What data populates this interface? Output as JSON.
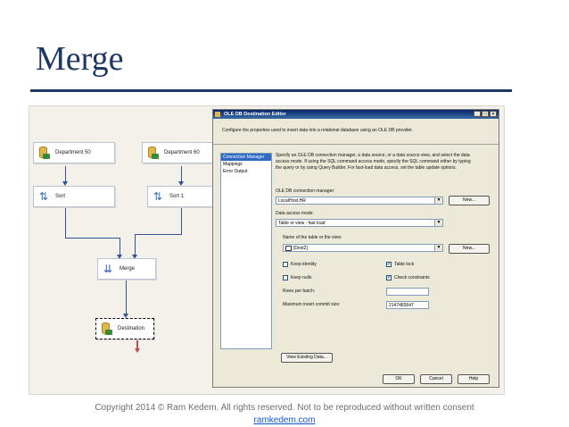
{
  "slide": {
    "title": "Merge",
    "copyright": "Copyright 2014 © Ram Kedem. All rights reserved. Not to be reproduced without written consent",
    "link": "ramkedem.com"
  },
  "flow": {
    "nodes": {
      "dept50": "Department 50",
      "dept60": "Department 60",
      "sort": "Sort",
      "sort1": "Sort 1",
      "merge": "Merge",
      "destination": "Destination"
    }
  },
  "dialog": {
    "title": "OLE DB Destination Editor",
    "window_buttons": [
      "_",
      "□",
      "×"
    ],
    "description": "Configure the properties used to insert data into a relational database using an OLE DB provider.",
    "nav": [
      "Connection Manager",
      "Mappings",
      "Error Output"
    ],
    "info_line1": "Specify an OLE DB connection manager, a data source, or a data source view, and select the data",
    "info_line2": "access mode. If using the SQL command access mode, specify the SQL command either by typing",
    "info_line3": "the query or by using Query Builder. For fast-load data access, set the table update options.",
    "conn_label": "OLE DB connection manager:",
    "conn_value": "LocalHost.HR",
    "new_button": "New...",
    "access_label": "Data access mode:",
    "access_value": "Table or view - fast load",
    "table_label": "Name of the table or the view:",
    "table_value": "[Dest2]",
    "keep_identity": "Keep identity",
    "keep_nulls": "Keep nulls",
    "table_lock": "Table lock",
    "check_constraints": "Check constraints",
    "rows_per_batch": "Rows per batch:",
    "max_commit": "Maximum insert commit size:",
    "max_commit_value": "2147483647",
    "view_existing": "View Existing Data...",
    "ok": "OK",
    "cancel": "Cancel",
    "help": "Help",
    "check_mark": "✔"
  },
  "colors": {
    "title": "#1f3864",
    "flow_line": "#2f5597",
    "error_line": "#c0504d",
    "link": "#1155cc"
  }
}
